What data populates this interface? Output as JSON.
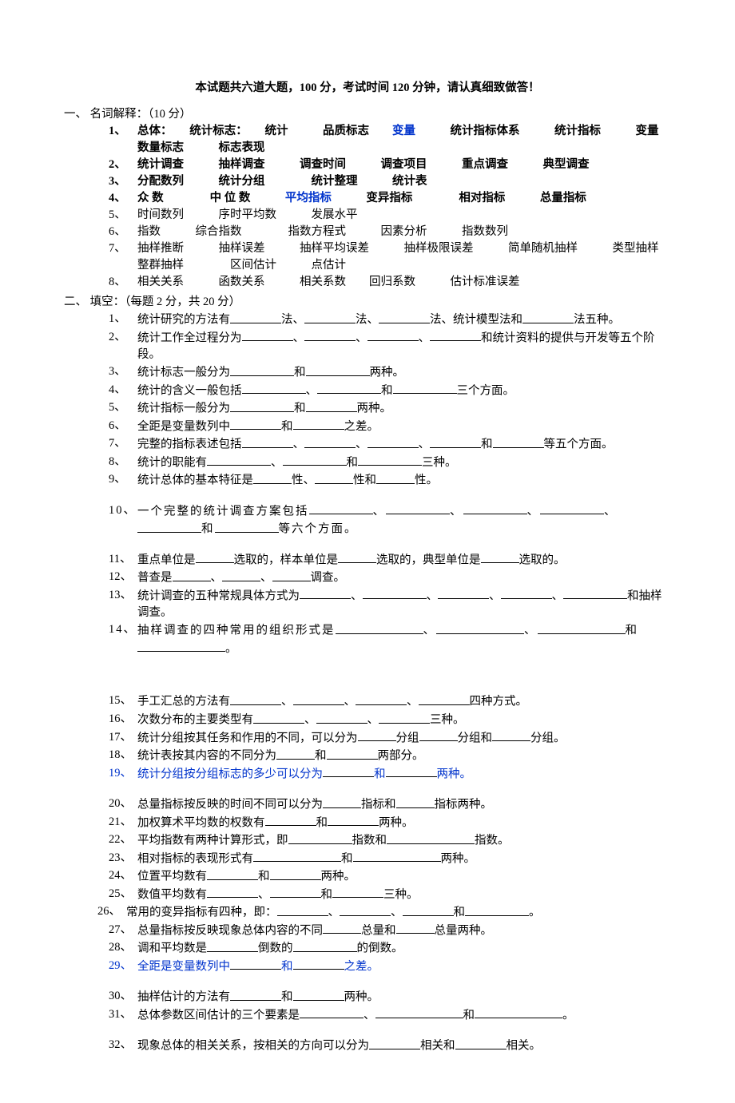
{
  "title": "本试题共六道大题，100 分，考试时间 120 分钟，请认真细致做答！",
  "sec1": {
    "header": "一、 名词解释：（10 分）",
    "items": [
      "总体：　　统计标志：　　统计　　　品质标志　　",
      "　　　统计指标体系　　　统计指标　　　变量　　数量标志　　　标志表现",
      "统计调查　　　抽样调查　　　调查时间　　　调查项目　　　重点调查　　　典型调查",
      "分配数列　　　统计分组　　　　统计整理　　　统计表",
      "众 数　　　　中 位 数　　　",
      "　　　变异指标　　　　相对指标　　　总量指标",
      "时间数列　　　序时平均数　　　发展水平",
      "指数　　　综合指数　　　　指数方程式　　　因素分析　　　指数数列",
      "抽样推断　　　抽样误差　　　抽样平均误差　　　抽样极限误差　　　简单随机抽样　　　类型抽样　　整群抽样　　　　区间估计　　　点估计",
      "相关关系　　　函数关系　　　相关系数　　回归系数　　　估计标准误差"
    ],
    "bianliang": "变量",
    "pingjun": "平均指标"
  },
  "sec2": {
    "header": "二、 填空：（每题 2 分，共 20 分）",
    "q1": [
      "统计研究的方法有",
      "法、",
      "法、",
      "法、统计模型法和",
      "法五种。"
    ],
    "q2": [
      "统计工作全过程分为",
      "、",
      "、",
      "、",
      "和统计资料的提供与开发等五个阶段。"
    ],
    "q3": [
      "统计标志一般分为",
      "和",
      "两种。"
    ],
    "q4": [
      "统计的含义一般包括",
      "、",
      "和",
      "三个方面。"
    ],
    "q5": [
      "统计指标一般分为",
      "和",
      "两种。"
    ],
    "q6": [
      "全距是变量数列中",
      "和",
      "之差。"
    ],
    "q7": [
      "完整的指标表述包括",
      "、",
      "、",
      "、",
      "和",
      "等五个方面。"
    ],
    "q8": [
      "统计的职能有",
      "、",
      "和",
      "三种。"
    ],
    "q9": [
      "统计总体的基本特征是",
      "性、",
      "性和",
      "性。"
    ],
    "q10": [
      "一个完整的统计调查方案包括",
      "、",
      "、",
      "、",
      "、",
      "和",
      "等六个方面。"
    ],
    "q11": [
      "重点单位是",
      "选取的，样本单位是",
      "选取的，典型单位是",
      "选取的。"
    ],
    "q12": [
      "普查是",
      "、",
      "、",
      "调查。"
    ],
    "q13": [
      "统计调查的五种常规具体方式为",
      "、",
      "、",
      "、",
      "、",
      "和抽样调查。"
    ],
    "q14": [
      "抽样调查的四种常用的组织形式是",
      "、",
      "、",
      "和",
      "。"
    ],
    "q15": [
      "手工汇总的方法有",
      "、",
      "、",
      "、",
      "四种方式。"
    ],
    "q16": [
      "次数分布的主要类型有",
      "、",
      "、",
      "三种。"
    ],
    "q17": [
      "统计分组按其任务和作用的不同，可以分为",
      "分组",
      "分组和",
      "分组。"
    ],
    "q18": [
      "统计表按其内容的不同分为",
      "和",
      "两部分。"
    ],
    "q19": [
      "统计分组按分组标志的多少可以分为",
      "和",
      "两种。"
    ],
    "q20": [
      "总量指标按反映的时间不同可以分为",
      "指标和",
      "指标两种。"
    ],
    "q21": [
      "加权算术平均数的权数有",
      "和",
      "两种。"
    ],
    "q22": [
      "平均指数有两种计算形式，即",
      "指数和",
      "指数。"
    ],
    "q23": [
      "相对指标的表现形式有",
      "和",
      "两种。"
    ],
    "q24": [
      "位置平均数有",
      "和",
      "两种。"
    ],
    "q25": [
      "数值平均数有",
      "、",
      "和",
      "三种。"
    ],
    "q26": [
      "常用的变异指标有四种，即：",
      "、",
      "、",
      "和",
      "。"
    ],
    "q27": [
      "总量指标按反映现象总体内容的不同",
      "总量和",
      "总量两种。"
    ],
    "q28": [
      "调和平均数是",
      "倒数的",
      "的倒数。"
    ],
    "q29": [
      "全距是变量数列中",
      "和",
      "之差。"
    ],
    "q30": [
      "抽样估计的方法有",
      "和",
      "两种。"
    ],
    "q31": [
      "总体参数区间估计的三个要素是",
      "、",
      "和",
      "。"
    ],
    "q32": [
      "现象总体的相关关系，按相关的方向可以分为",
      "相关和",
      "相关。"
    ]
  }
}
